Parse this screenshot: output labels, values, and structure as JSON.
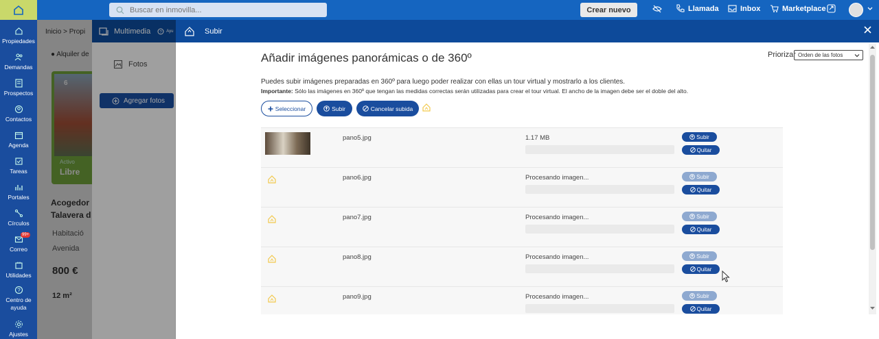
{
  "topbar": {
    "search_placeholder": "Buscar en inmovilla...",
    "crear_nuevo": "Crear nuevo",
    "actions": [
      "Llamada",
      "Inbox",
      "Marketplace"
    ]
  },
  "sidebar": {
    "items": [
      {
        "label": "Propiedades",
        "icon": "home-icon"
      },
      {
        "label": "Demandas",
        "icon": "users-icon"
      },
      {
        "label": "Prospectos",
        "icon": "list-icon"
      },
      {
        "label": "Contactos",
        "icon": "contact-icon"
      },
      {
        "label": "Agenda",
        "icon": "calendar-icon"
      },
      {
        "label": "Tareas",
        "icon": "tasks-icon"
      },
      {
        "label": "Portales",
        "icon": "portals-icon"
      },
      {
        "label": "Círculos",
        "icon": "circles-icon"
      },
      {
        "label": "Correo",
        "icon": "mail-icon",
        "badge": "99+"
      },
      {
        "label": "Utilidades",
        "icon": "tools-icon"
      },
      {
        "label": "Centro de ayuda",
        "icon": "help-icon"
      },
      {
        "label": "Ajustes",
        "icon": "gear-icon"
      }
    ]
  },
  "background": {
    "breadcrumb": "Inicio  >  Propi",
    "alquiler": "Alquiler de",
    "photo_count": "6",
    "activo": "Activo",
    "libre": "Libre",
    "title_line1": "Acogedor",
    "title_line2": "Talavera d",
    "habitacion": "Habitació",
    "avenida": "Avenida",
    "price": "800 €",
    "m2": "12 m²"
  },
  "multimedia": {
    "title": "Multimedia",
    "help": "Ayu",
    "tab_fotos": "Fotos",
    "add_photos": "Agregar fotos"
  },
  "modal": {
    "header_title": "Subir",
    "title": "Añadir imágenes panorámicas o de 360º",
    "priorizar": "Priorizar",
    "sort_value": "Orden de las fotos",
    "description": "Puedes subir imágenes preparadas en 360º para luego poder realizar con ellas un tour virtual y mostrarlo a los clientes.",
    "important_label": "Importante:",
    "important_text": " Sólo las imágenes en 360º que tengan las medidas correctas serán utilizadas para crear el tour virtual. El ancho de la imagen debe ser el doble del alto.",
    "btn_select": "Seleccionar",
    "btn_upload": "Subir",
    "btn_cancel": "Cancelar subida",
    "row_upload": "Subir",
    "row_remove": "Quitar",
    "files": [
      {
        "name": "pano5.jpg",
        "status": "1.17 MB",
        "has_thumb": true
      },
      {
        "name": "pano6.jpg",
        "status": "Procesando imagen...",
        "has_thumb": false
      },
      {
        "name": "pano7.jpg",
        "status": "Procesando imagen...",
        "has_thumb": false
      },
      {
        "name": "pano8.jpg",
        "status": "Procesando imagen...",
        "has_thumb": false
      },
      {
        "name": "pano9.jpg",
        "status": "Procesando imagen...",
        "has_thumb": false
      }
    ]
  },
  "colors": {
    "primary": "#1a4d9e",
    "header": "#0d4a9a",
    "topbar": "#1565c0",
    "accent_yellow": "#f2c94c"
  }
}
